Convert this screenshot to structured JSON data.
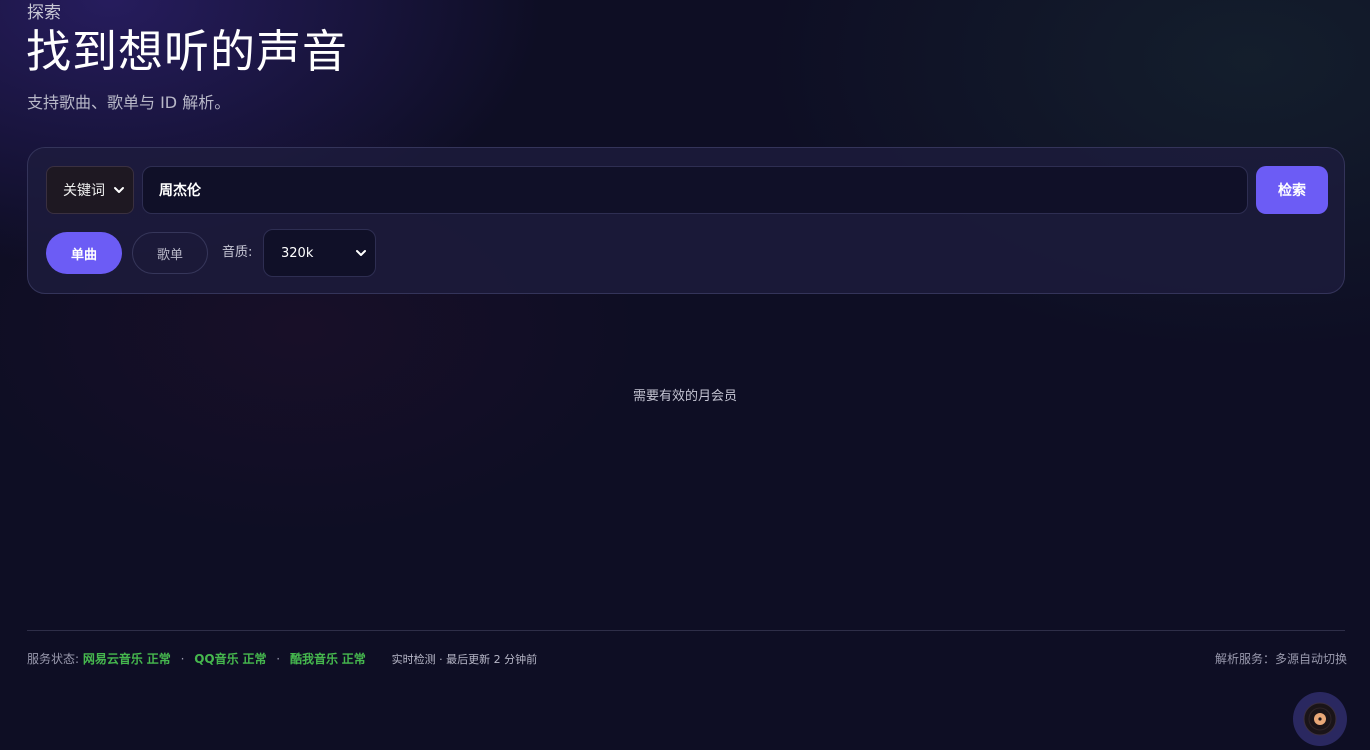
{
  "header": {
    "eyebrow": "探索",
    "title": "找到想听的声音",
    "subtitle": "支持歌曲、歌单与 ID 解析。"
  },
  "search": {
    "mode_selected": "关键词",
    "query": "周杰伦",
    "button_label": "检索",
    "tabs": [
      {
        "label": "单曲",
        "active": true
      },
      {
        "label": "歌单",
        "active": false
      }
    ],
    "quality_label": "音质:",
    "quality_selected": "320k"
  },
  "results": {
    "empty_message": "需要有效的月会员"
  },
  "footer": {
    "status_label": "服务状态:",
    "services": [
      {
        "name": "网易云音乐",
        "status": "正常"
      },
      {
        "name": "QQ音乐",
        "status": "正常"
      },
      {
        "name": "酷我音乐",
        "status": "正常"
      }
    ],
    "separator": "·",
    "detection_text": "实时检测 · 最后更新 2 分钟前",
    "resolver_text": "解析服务：多源自动切换"
  },
  "colors": {
    "accent": "#6c5cf5",
    "status_ok": "#46b84e",
    "background": "#0e0e24"
  },
  "icons": {
    "select_chevron": "chevron-down-icon",
    "player": "vinyl-disc-icon"
  }
}
